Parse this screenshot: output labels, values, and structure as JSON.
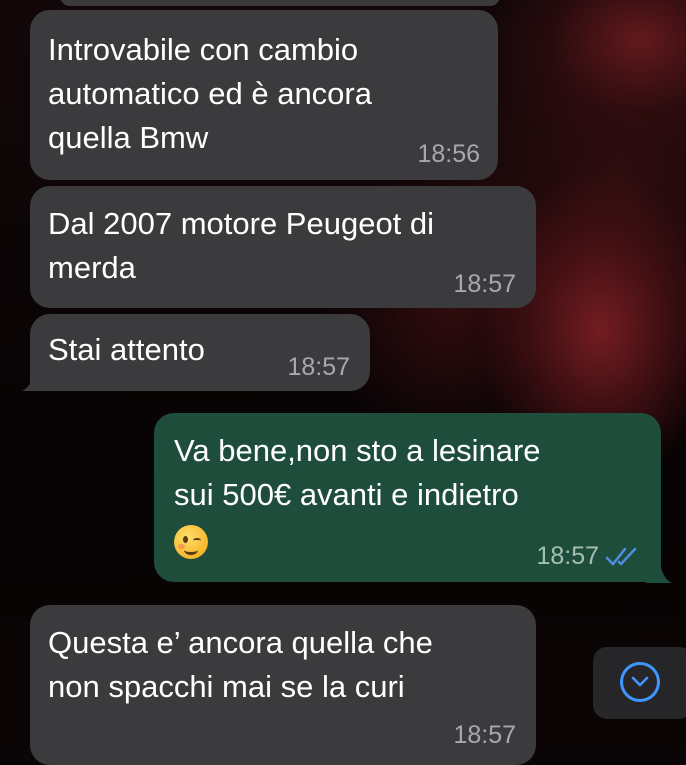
{
  "chat": {
    "messages": [
      {
        "direction": "incoming",
        "text": "Introvabile con cambio\nautomatico ed è ancora\nquella Bmw",
        "time": "18:56"
      },
      {
        "direction": "incoming",
        "text": "Dal 2007 motore Peugeot di\nmerda",
        "time": "18:57"
      },
      {
        "direction": "incoming",
        "text": "Stai attento",
        "time": "18:57"
      },
      {
        "direction": "outgoing",
        "text": "Va bene,non sto a lesinare\nsui 500€ avanti e indietro",
        "emoji": "winking-face",
        "time": "18:57",
        "status": "read"
      },
      {
        "direction": "incoming",
        "text": "Questa e’ ancora quella che\nnon spacchi mai se la curi",
        "time": "18:57"
      }
    ],
    "scroll_down_icon": "chevron-down-circle-icon"
  },
  "colors": {
    "incoming_bubble": "#3b3b3d",
    "outgoing_bubble": "#1f4d3c",
    "read_ticks": "#4a90e2",
    "accent": "#3e96ff"
  }
}
